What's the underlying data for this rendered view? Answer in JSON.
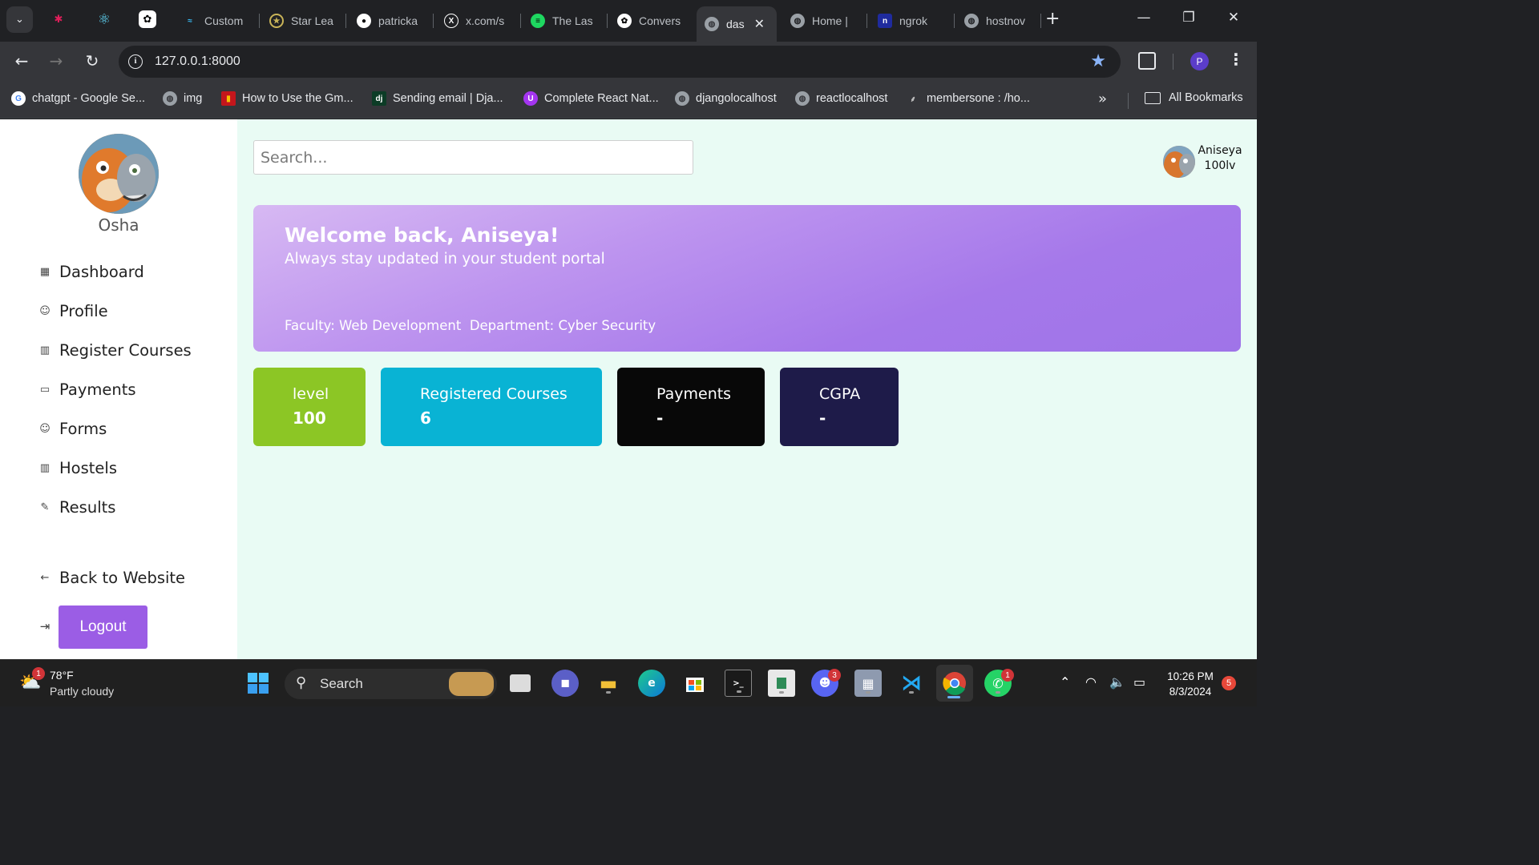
{
  "browser": {
    "tabs": [
      {
        "label": "Custom",
        "icon": "tailwind-icon",
        "active": false
      },
      {
        "label": "Star Lea",
        "icon": "star-league-icon",
        "active": false
      },
      {
        "label": "patricka",
        "icon": "github-icon",
        "active": false
      },
      {
        "label": "x.com/s",
        "icon": "x-icon",
        "active": false
      },
      {
        "label": "The Las",
        "icon": "spotify-icon",
        "active": false
      },
      {
        "label": "Convers",
        "icon": "chatgpt-icon",
        "active": false
      },
      {
        "label": "das",
        "icon": "globe-icon",
        "active": true
      },
      {
        "label": "Home |",
        "icon": "globe-icon",
        "active": false
      },
      {
        "label": "ngrok",
        "icon": "ngrok-icon",
        "active": false
      },
      {
        "label": "hostnov",
        "icon": "globe-icon",
        "active": false
      }
    ],
    "url": "127.0.0.1:8000",
    "profile_initial": "P",
    "bookmarks": [
      {
        "label": "chatgpt - Google Se...",
        "icon": "google-icon"
      },
      {
        "label": "img",
        "icon": "globe-icon"
      },
      {
        "label": "How to Use the Gm...",
        "icon": "video-icon"
      },
      {
        "label": "Sending email | Dja...",
        "icon": "django-icon"
      },
      {
        "label": "Complete React Nat...",
        "icon": "udemy-icon"
      },
      {
        "label": "djangolocalhost",
        "icon": "globe-icon"
      },
      {
        "label": "reactlocalhost",
        "icon": "globe-icon"
      },
      {
        "label": "membersone : /ho...",
        "icon": "feather-icon"
      }
    ],
    "all_bookmarks": "All Bookmarks"
  },
  "sidebar": {
    "name": "Osha",
    "items": [
      {
        "label": "Dashboard",
        "icon": "grid-icon"
      },
      {
        "label": "Profile",
        "icon": "user-circle-icon"
      },
      {
        "label": "Register Courses",
        "icon": "building-icon"
      },
      {
        "label": "Payments",
        "icon": "card-icon"
      },
      {
        "label": "Forms",
        "icon": "user-circle-icon"
      },
      {
        "label": "Hostels",
        "icon": "building-icon"
      },
      {
        "label": "Results",
        "icon": "pen-icon"
      }
    ],
    "back_label": "Back to Website",
    "logout_label": "Logout"
  },
  "main": {
    "search_placeholder": "Search...",
    "user": {
      "name": "Aniseya",
      "level": "100lv"
    },
    "banner": {
      "title": "Welcome back,  Aniseya!",
      "subtitle": "Always stay updated in your student portal",
      "info": "Faculty: Web Development  Department: Cyber Security"
    },
    "cards": [
      {
        "label": "level",
        "value": "100",
        "color": "#8cc625"
      },
      {
        "label": "Registered Courses",
        "value": "6",
        "color": "#09b3d4"
      },
      {
        "label": "Payments",
        "value": "-",
        "color": "#080808"
      },
      {
        "label": "CGPA",
        "value": "-",
        "color": "#1e1b49"
      }
    ]
  },
  "taskbar": {
    "weather_temp": "78°F",
    "weather_desc": "Partly cloudy",
    "weather_badge": "1",
    "search_label": "Search",
    "discord_badge": "3",
    "whatsapp_badge": "1",
    "time": "10:26 PM",
    "date": "8/3/2024",
    "notification_count": "5"
  },
  "colors": {
    "accent": "#9b5de5",
    "page_bg": "#e9fbf4"
  }
}
